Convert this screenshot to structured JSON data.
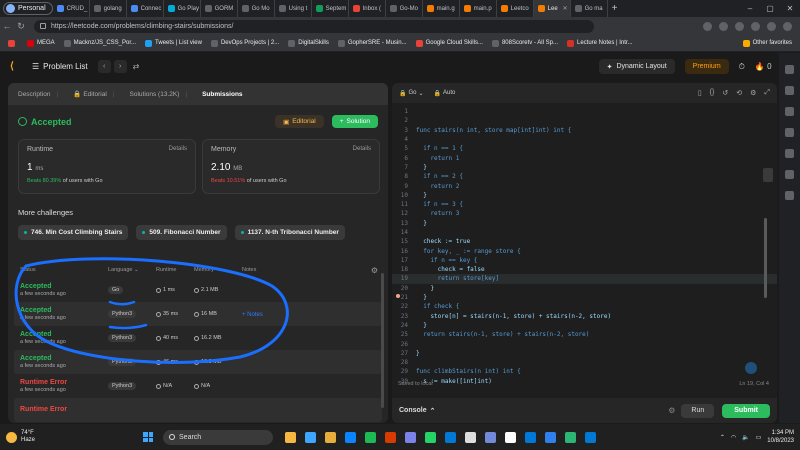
{
  "browser": {
    "profile": "Personal",
    "tabs": [
      {
        "label": "CRUD_",
        "color": "#4b8bf5"
      },
      {
        "label": "golang",
        "color": "#5f6368"
      },
      {
        "label": "Connec",
        "color": "#4b8bf5"
      },
      {
        "label": "Go Play",
        "color": "#00add8"
      },
      {
        "label": "GORM",
        "color": "#5f6368"
      },
      {
        "label": "Go Mo",
        "color": "#5f6368"
      },
      {
        "label": "Using t",
        "color": "#5f6368"
      },
      {
        "label": "Septem",
        "color": "#0f9d58"
      },
      {
        "label": "Inbox (",
        "color": "#ea4335"
      },
      {
        "label": "Go-Mo",
        "color": "#5f6368"
      },
      {
        "label": "main.g",
        "color": "#f57c00"
      },
      {
        "label": "main.p",
        "color": "#f57c00"
      },
      {
        "label": "Leetco",
        "color": "#f57c00"
      },
      {
        "label": "Lee",
        "color": "#f57c00",
        "active": true
      },
      {
        "label": "Go ma",
        "color": "#5f6368"
      }
    ],
    "url": "https://leetcode.com/problems/climbing-stairs/submissions/",
    "bookmarks": [
      {
        "label": "",
        "color": "#ea4335"
      },
      {
        "label": "MEGA",
        "color": "#d90007"
      },
      {
        "label": "Macknz/JS_CSS_Por...",
        "color": "#5f6368"
      },
      {
        "label": "Tweets | List view",
        "color": "#1da1f2"
      },
      {
        "label": "DevOps Projects | 2...",
        "color": "#5f6368"
      },
      {
        "label": "DigitalSkills",
        "color": "#5f6368"
      },
      {
        "label": "GopherSRE - Musin...",
        "color": "#5f6368"
      },
      {
        "label": "Google Cloud Skills...",
        "color": "#ea4335"
      },
      {
        "label": "808Scoretv - All Sp...",
        "color": "#5f6368"
      },
      {
        "label": "Lecture Notes | Intr...",
        "color": "#d93025"
      },
      {
        "label": "Other favorites",
        "color": "#f9ab00"
      }
    ]
  },
  "lc": {
    "problem_list": "Problem List",
    "dynamic_layout": "Dynamic Layout",
    "premium": "Premium",
    "streak": "0"
  },
  "left": {
    "tabs": [
      "Description",
      "Editorial",
      "Solutions (13.2K)",
      "Submissions"
    ],
    "status": "Accepted",
    "editorial_btn": "Editorial",
    "solution_btn": "Solution",
    "runtime": {
      "label": "Runtime",
      "details": "Details",
      "value": "1",
      "unit": "ms",
      "beats_pct": "Beats 80.39%",
      "beats_rest": " of users with Go"
    },
    "memory": {
      "label": "Memory",
      "details": "Details",
      "value": "2.10",
      "unit": "MB",
      "beats_pct": "Beats 10.51%",
      "beats_rest": " of users with Go"
    },
    "more_title": "More challenges",
    "challenges": [
      "746. Min Cost Climbing Stairs",
      "509. Fibonacci Number",
      "1137. N-th Tribonacci Number"
    ],
    "headers": {
      "status": "Status",
      "language": "Language",
      "runtime": "Runtime",
      "memory": "Memory",
      "notes": "Notes"
    },
    "rows": [
      {
        "status": "Accepted",
        "when": "a few seconds ago",
        "lang": "Go",
        "runtime": "1 ms",
        "memory": "2.1 MB",
        "notes": "",
        "ok": true
      },
      {
        "status": "Accepted",
        "when": "a few seconds ago",
        "lang": "Python3",
        "runtime": "35 ms",
        "memory": "16 MB",
        "notes": "+ Notes",
        "ok": true
      },
      {
        "status": "Accepted",
        "when": "a few seconds ago",
        "lang": "Python3",
        "runtime": "40 ms",
        "memory": "16.2 MB",
        "notes": "",
        "ok": true
      },
      {
        "status": "Accepted",
        "when": "a few seconds ago",
        "lang": "Python3",
        "runtime": "46 ms",
        "memory": "16.3 MB",
        "notes": "",
        "ok": true
      },
      {
        "status": "Runtime Error",
        "when": "a few seconds ago",
        "lang": "Python3",
        "runtime": "N/A",
        "memory": "N/A",
        "notes": "",
        "ok": false
      },
      {
        "status": "Runtime Error",
        "when": "",
        "lang": "",
        "runtime": "",
        "memory": "",
        "notes": "",
        "ok": false
      }
    ]
  },
  "editor": {
    "language": "Go",
    "mode": "Auto",
    "lines": [
      "",
      "",
      "func stairs(n int, store map[int]int) int {",
      "",
      "  if n == 1 {",
      "    return 1",
      "  }",
      "  if n == 2 {",
      "    return 2",
      "  }",
      "  if n == 3 {",
      "    return 3",
      "  }",
      "",
      "  check := true",
      "  for key, _ := range store {",
      "    if n == key {",
      "      check = false",
      "      return store[key]",
      "    }",
      "  }",
      "  if check {",
      "    store[n] = stairs(n-1, store) + stairs(n-2, store)",
      "  }",
      "  return stairs(n-1, store) + stairs(n-2, store)",
      "",
      "}",
      "",
      "func climbStairs(n int) int {",
      "  s := make([int]int)"
    ],
    "saved": "Saved to local",
    "position": "Ln 19, Col 4",
    "console": "Console",
    "run": "Run",
    "submit": "Submit"
  },
  "taskbar": {
    "temp": "74°F",
    "weather": "Haze",
    "search": "Search",
    "time": "1:34 PM",
    "date": "10/8/2023",
    "apps": [
      "#f5b942",
      "#3ea6ff",
      "#e8ae3b",
      "#0a84ff",
      "#1db954",
      "#d83b01",
      "#7b83eb",
      "#25d366",
      "#0078d4",
      "#dddddd",
      "#7289da",
      "#ffffff",
      "#0078d7",
      "#2f80ed",
      "#2bb673",
      "#0078d4"
    ]
  },
  "colors": {
    "accepted": "#2cbb5d",
    "error": "#ef4743",
    "annotation": "#1a6fff"
  }
}
